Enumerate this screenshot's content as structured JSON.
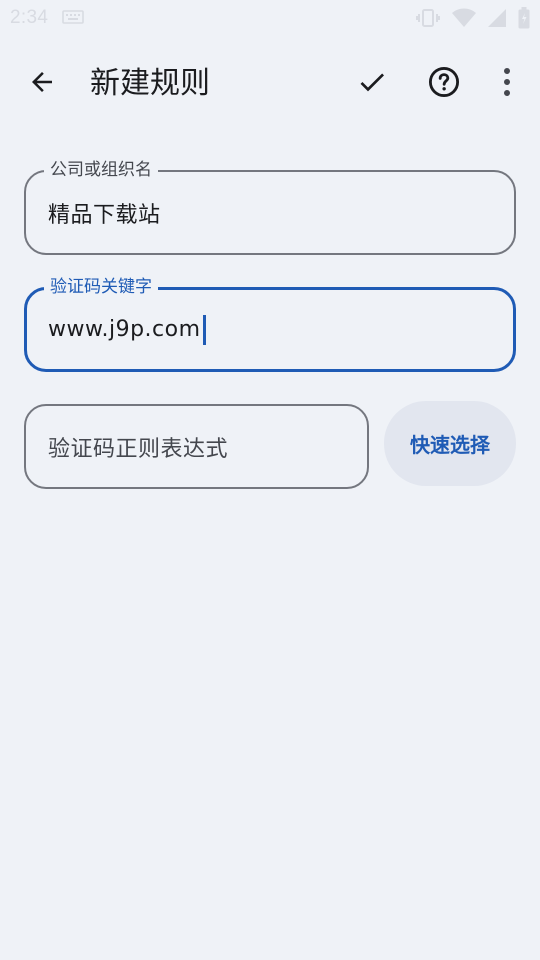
{
  "status_bar": {
    "time": "2:34"
  },
  "app_bar": {
    "title": "新建规则",
    "icons": [
      "back-arrow-icon",
      "check-icon",
      "help-icon",
      "more-vert-icon"
    ]
  },
  "form": {
    "company": {
      "label": "公司或组织名",
      "value": "精品下载站"
    },
    "keyword": {
      "label": "验证码关键字",
      "value": "www.j9p.com"
    },
    "regex": {
      "placeholder": "验证码正则表达式"
    },
    "quick_select_label": "快速选择"
  },
  "colors": {
    "background": "#eff2f7",
    "accent": "#1f5bb5",
    "outline": "#74777f",
    "tonal_button": "#e2e6ef"
  }
}
